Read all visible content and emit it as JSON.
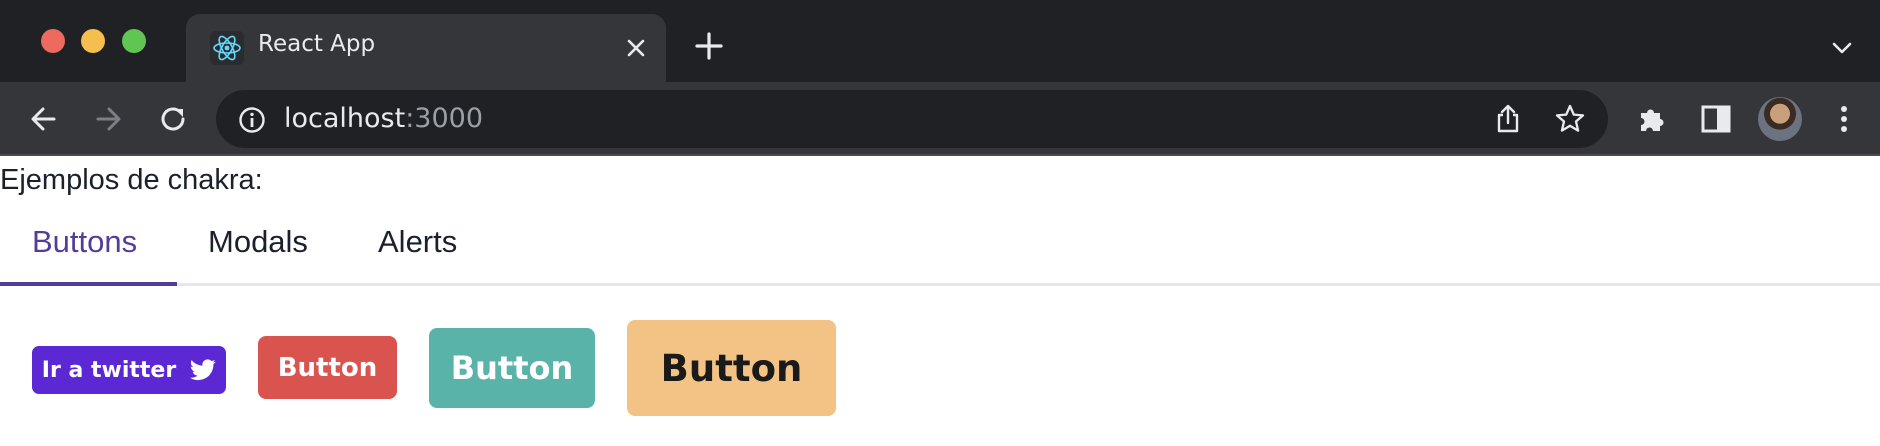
{
  "browser": {
    "tab": {
      "title": "React App",
      "favicon": "react-atom-icon"
    },
    "address": {
      "host": "localhost",
      "port": ":3000"
    },
    "icons": {
      "back": "arrow-left-icon",
      "forward": "arrow-right-icon",
      "reload": "reload-icon",
      "info": "info-icon",
      "share": "share-icon",
      "bookmark": "star-icon",
      "extensions": "puzzle-icon",
      "side_panel": "side-panel-icon",
      "menu": "kebab-icon"
    },
    "colors": {
      "tab_bg": "#35363a",
      "frame_bg": "#202124",
      "text": "#e8eaed"
    }
  },
  "page": {
    "intro": "Ejemplos de chakra:",
    "tabs": [
      {
        "label": "Buttons",
        "active": true
      },
      {
        "label": "Modals",
        "active": false
      },
      {
        "label": "Alerts",
        "active": false
      }
    ],
    "buttons": [
      {
        "label": "Ir a twitter",
        "icon": "twitter-bird-icon",
        "color": "#5c28d3"
      },
      {
        "label": "Button",
        "color": "#d9534f"
      },
      {
        "label": "Button",
        "color": "#5ab3a8"
      },
      {
        "label": "Button",
        "color": "#f3c386"
      }
    ],
    "accent": "#553c9a"
  }
}
